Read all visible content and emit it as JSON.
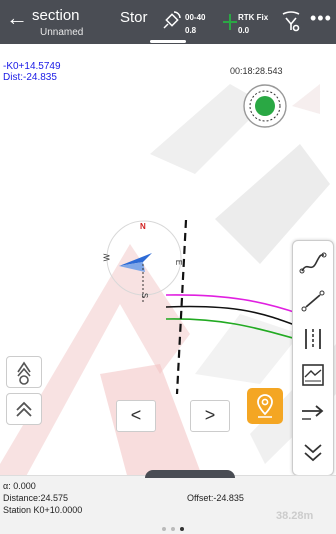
{
  "header": {
    "back_label": "←",
    "title": "section",
    "subtitle": "Unnamed",
    "store": "Stor",
    "sat_top": "00-40",
    "sat_bottom": "0.8",
    "fix_top": "RTK Fix",
    "fix_bottom": "0.0",
    "more_label": "•••"
  },
  "map": {
    "mileage": "-K0+14.5749",
    "dist": "Dist:-24.835",
    "timer": "00:18:28.543",
    "compass_n": "N",
    "compass_e": "E",
    "compass_w": "W",
    "compass_s": "S"
  },
  "nav": {
    "prev_label": "<",
    "next_label": ">"
  },
  "footer": {
    "angle": "α: 0.000",
    "distance": "Distance:24.575",
    "offset": "Offset:-24.835",
    "station": "Station K0+10.0000",
    "scale": "38.28m"
  },
  "colors": {
    "topbar": "#4a4d54",
    "accent_orange": "#f4a623",
    "record_green": "#2aa844",
    "blue_text": "#1a1ae6"
  },
  "icons": [
    "back-icon",
    "satellite-icon",
    "fix-icon",
    "radio-icon",
    "more-icon",
    "record-icon",
    "compass-icon",
    "curve-icon",
    "stakeout-point-icon",
    "stakeout-line-icon",
    "profile-icon",
    "direction-icon",
    "collapse-icon",
    "antenna-icon",
    "expand-up-icon",
    "location-pin-icon"
  ]
}
